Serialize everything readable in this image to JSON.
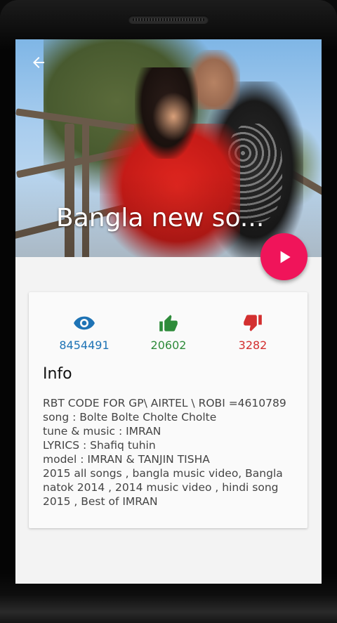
{
  "header": {
    "title": "Bangla new so..."
  },
  "stats": {
    "views": "8454491",
    "likes": "20602",
    "dislikes": "3282",
    "colors": {
      "views": "#1e73b5",
      "likes": "#2e8b3a",
      "dislikes": "#d32f2f"
    }
  },
  "info": {
    "title": "Info",
    "lines": [
      "RBT CODE FOR GP\\ AIRTEL \\ ROBI =4610789",
      "song : Bolte Bolte Cholte Cholte",
      "tune & music : IMRAN",
      "LYRICS : Shafiq tuhin",
      "model : IMRAN & TANJIN TISHA",
      "2015 all songs , bangla music video, Bangla",
      "natok 2014 , 2014 music video , hindi song",
      "2015 , Best  of IMRAN"
    ]
  },
  "icons": {
    "back": "arrow-left-icon",
    "play": "play-icon",
    "views": "eye-icon",
    "likes": "thumbs-up-icon",
    "dislikes": "thumbs-down-icon"
  },
  "accent": "#f0145a"
}
